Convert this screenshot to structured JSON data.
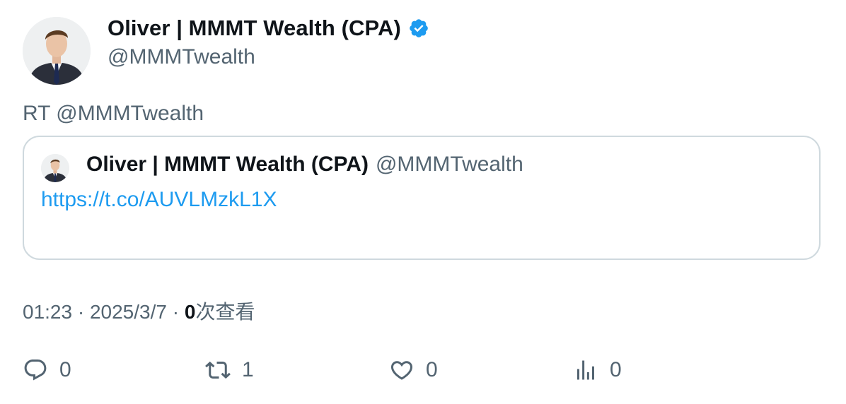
{
  "author": {
    "display_name": "Oliver | MMMT Wealth (CPA)",
    "handle": "@MMMTwealth",
    "verified": true,
    "verified_color": "#1d9bf0"
  },
  "tweet": {
    "text": "RT @MMMTwealth"
  },
  "quoted": {
    "display_name": "Oliver | MMMT Wealth (CPA)",
    "handle": "@MMMTwealth",
    "link": "https://t.co/AUVLMzkL1X"
  },
  "meta": {
    "time": "01:23",
    "separator": " · ",
    "date": "2025/3/7",
    "views_count": "0",
    "views_label": "次查看"
  },
  "actions": {
    "reply_count": "0",
    "retweet_count": "1",
    "like_count": "0",
    "views_count": "0"
  },
  "colors": {
    "text_primary": "#0f1419",
    "text_secondary": "#536471",
    "link": "#1d9bf0",
    "border": "#cfd9de"
  }
}
